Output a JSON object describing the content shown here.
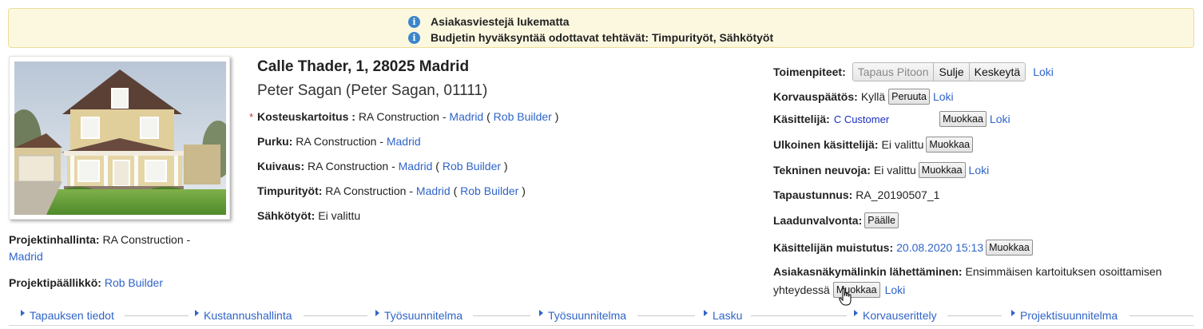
{
  "notices": [
    {
      "icon": "info-icon",
      "text": "Asiakasviestejä lukematta"
    },
    {
      "icon": "info-icon",
      "text": "Budjetin hyväksyntää odottavat tehtävät: Timpurityöt, Sähkötyöt"
    }
  ],
  "property": {
    "address": "Calle Thader, 1, 28025 Madrid",
    "owner": "Peter Sagan (Peter Sagan, 01111)"
  },
  "left": {
    "pm_label": "Projektinhallinta:",
    "pm_company": "RA Construction -",
    "pm_city": "Madrid",
    "lead_label": "Projektipäällikkö:",
    "lead_name": "Rob Builder"
  },
  "trades": [
    {
      "required": true,
      "label": "Kosteuskartoitus :",
      "company": "RA Construction - ",
      "city": "Madrid",
      "open": " ( ",
      "person": "Rob Builder",
      "close": " )"
    },
    {
      "required": false,
      "label": "Purku:",
      "company": "RA Construction - ",
      "city": "Madrid",
      "open": "",
      "person": "",
      "close": ""
    },
    {
      "required": false,
      "label": "Kuivaus:",
      "company": "RA Construction - ",
      "city": "Madrid",
      "open": " ( ",
      "person": "Rob Builder",
      "close": " )"
    },
    {
      "required": false,
      "label": "Timpurityöt:",
      "company": "RA Construction - ",
      "city": "Madrid",
      "open": " ( ",
      "person": "Rob Builder",
      "close": " )"
    },
    {
      "required": false,
      "label": "Sähkötyöt:",
      "company": "Ei valittu",
      "city": "",
      "open": "",
      "person": "",
      "close": ""
    }
  ],
  "actions": {
    "toimenpiteet_label": "Toimenpiteet:",
    "buttons": [
      "Tapaus Pitoon",
      "Sulje",
      "Keskeytä"
    ],
    "loki": "Loki",
    "korvauspaatos_label": "Korvauspäätös:",
    "korvauspaatos_value": "Kyllä",
    "peruuta": "Peruuta",
    "kasittelija_label": "Käsittelijä:",
    "kasittelija_value": "C Customer",
    "muokkaa": "Muokkaa",
    "ulkoinen_label": "Ulkoinen käsittelijä:",
    "ulkoinen_value": "Ei valittu",
    "tekninen_label": "Tekninen neuvoja:",
    "tekninen_value": "Ei valittu",
    "tapaustunnus_label": "Tapaustunnus:",
    "tapaustunnus_value": "RA_20190507_1",
    "laadunvalvonta_label": "Laadunvalvonta:",
    "paalle": "Päälle",
    "muistutus_label": "Käsittelijän muistutus:",
    "muistutus_value": "20.08.2020 15:13",
    "asiakas_label": "Asiakasnäkymälinkin lähettäminen:",
    "asiakas_value_1": "Ensimmäisen kartoituksen osoittamisen",
    "asiakas_value_2": "yhteydessä"
  },
  "nav": [
    "Tapauksen tiedot",
    "Kustannushallinta",
    "Työsuunnitelma",
    "Työsuunnitelma",
    "Lasku",
    "Korvauserittely",
    "Projektisuunnitelma"
  ],
  "colors": {
    "link": "#2f64c8",
    "notice_bg": "#fcf8e0",
    "info_icon": "#3b86c8",
    "required_star": "#c0392b"
  }
}
